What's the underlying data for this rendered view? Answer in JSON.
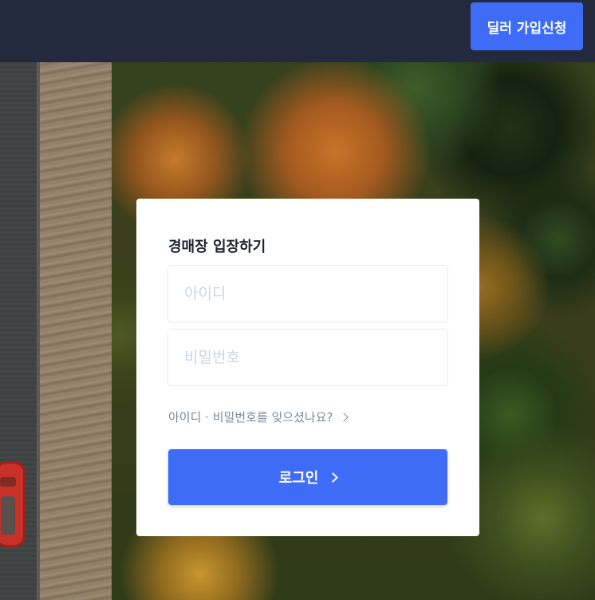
{
  "header": {
    "signup_label": "딜러 가입신청"
  },
  "login": {
    "title": "경매장 입장하기",
    "id_placeholder": "아이디",
    "password_placeholder": "비밀번호",
    "forgot_label": "아이디 · 비밀번호를 잊으셨나요?",
    "submit_label": "로그인"
  },
  "icons": {
    "forgot_arrow": "chevron-right-icon",
    "submit_arrow": "chevron-right-icon"
  },
  "colors": {
    "header_bg": "#242a3d",
    "primary": "#3e6cf6",
    "card_bg": "#ffffff",
    "link": "#7c879c"
  }
}
